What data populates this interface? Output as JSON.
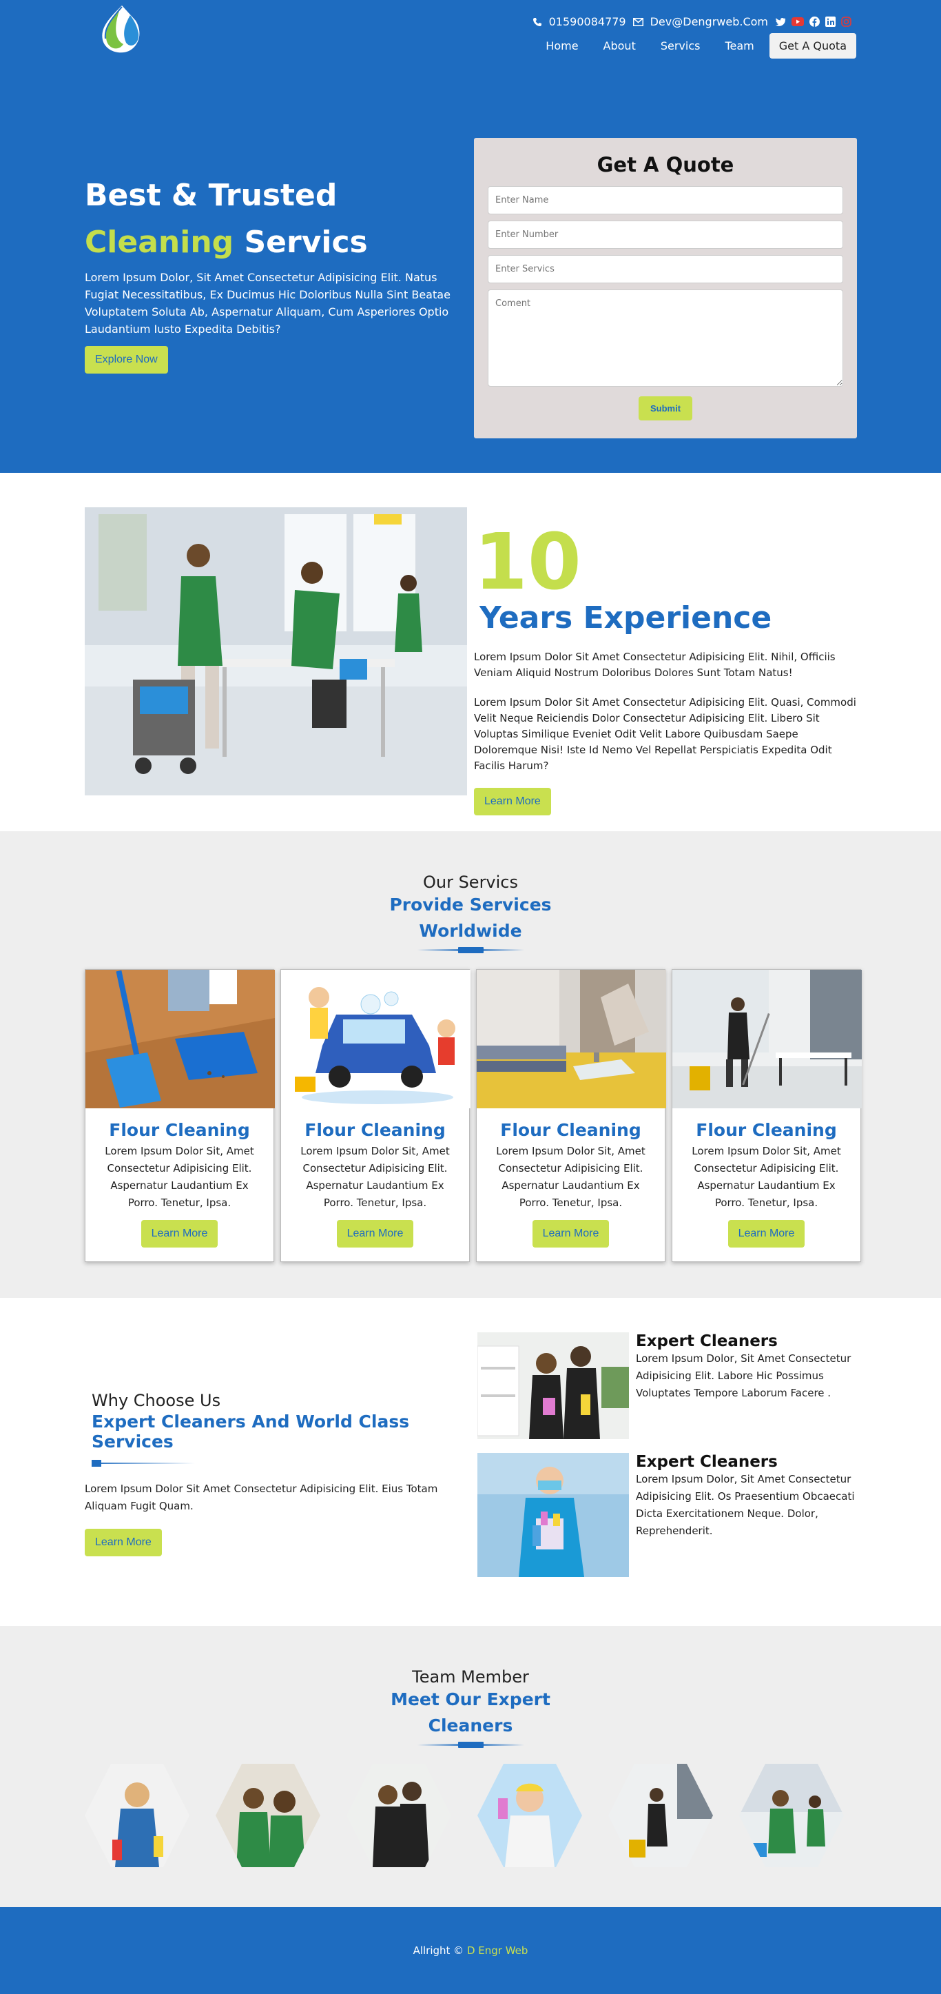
{
  "header": {
    "phone": "01590084779",
    "email": "Dev@Dengrweb.Com",
    "social_icons": [
      "twitter-icon",
      "youtube-icon",
      "facebook-icon",
      "linkedin-icon",
      "instagram-icon"
    ],
    "nav": [
      "Home",
      "About",
      "Servics",
      "Team",
      "Get A Quota"
    ]
  },
  "hero": {
    "title_line1": "Best & Trusted",
    "title_highlight": "Cleaning",
    "title_rest": "Servics",
    "description": "Lorem Ipsum Dolor, Sit Amet Consectetur Adipisicing Elit. Natus Fugiat Necessitatibus, Ex Ducimus Hic Doloribus Nulla Sint Beatae Voluptatem Soluta Ab, Aspernatur Aliquam, Cum Asperiores Optio Laudantium Iusto Expedita Debitis?",
    "button": "Explore Now"
  },
  "quote_form": {
    "title": "Get A Quote",
    "name_placeholder": "Enter Name",
    "number_placeholder": "Enter Number",
    "service_placeholder": "Enter Servics",
    "comment_placeholder": "Coment",
    "submit": "Submit"
  },
  "experience": {
    "number": "10",
    "label": "Years Experience",
    "para1": "Lorem Ipsum Dolor Sit Amet Consectetur Adipisicing Elit. Nihil, Officiis Veniam Aliquid Nostrum Doloribus Dolores Sunt Totam Natus!",
    "para2": "Lorem Ipsum Dolor Sit Amet Consectetur Adipisicing Elit. Quasi, Commodi Velit Neque Reiciendis Dolor Consectetur Adipisicing Elit. Libero Sit Voluptas Similique Eveniet Odit Velit Labore Quibusdam Saepe Doloremque Nisi! Iste Id Nemo Vel Repellat Perspiciatis Expedita Odit Facilis Harum?",
    "button": "Learn More"
  },
  "services": {
    "subtitle": "Our Servics",
    "title_line1": "Provide Services",
    "title_line2": "Worldwide",
    "cards": [
      {
        "title": "Flour Cleaning",
        "text": "Lorem Ipsum Dolor Sit, Amet Consectetur Adipisicing Elit. Aspernatur Laudantium Ex Porro. Tenetur, Ipsa.",
        "button": "Learn More"
      },
      {
        "title": "Flour Cleaning",
        "text": "Lorem Ipsum Dolor Sit, Amet Consectetur Adipisicing Elit. Aspernatur Laudantium Ex Porro. Tenetur, Ipsa.",
        "button": "Learn More"
      },
      {
        "title": "Flour Cleaning",
        "text": "Lorem Ipsum Dolor Sit, Amet Consectetur Adipisicing Elit. Aspernatur Laudantium Ex Porro. Tenetur, Ipsa.",
        "button": "Learn More"
      },
      {
        "title": "Flour Cleaning",
        "text": "Lorem Ipsum Dolor Sit, Amet Consectetur Adipisicing Elit. Aspernatur Laudantium Ex Porro. Tenetur, Ipsa.",
        "button": "Learn More"
      }
    ]
  },
  "why": {
    "subtitle": "Why Choose Us",
    "title": "Expert Cleaners And World Class Services",
    "text": "Lorem Ipsum Dolor Sit Amet Consectetur Adipisicing Elit. Eius Totam Aliquam Fugit Quam.",
    "button": "Learn More",
    "items": [
      {
        "title": "Expert Cleaners",
        "text": "Lorem Ipsum Dolor, Sit Amet Consectetur Adipisicing Elit. Labore Hic Possimus Voluptates Tempore Laborum Facere ."
      },
      {
        "title": "Expert Cleaners",
        "text": "Lorem Ipsum Dolor, Sit Amet Consectetur Adipisicing Elit. Os Praesentium Obcaecati Dicta Exercitationem Neque. Dolor, Reprehenderit."
      }
    ]
  },
  "team": {
    "subtitle": "Team Member",
    "title_line1": "Meet Our Expert",
    "title_line2": "Cleaners"
  },
  "footer": {
    "prefix": "Allright ©",
    "brand": "D Engr Web"
  },
  "colors": {
    "primary_blue": "#1e6cc0",
    "lime": "#c9e04f",
    "light_gray": "#eeeeee",
    "form_bg": "#e0dada"
  }
}
